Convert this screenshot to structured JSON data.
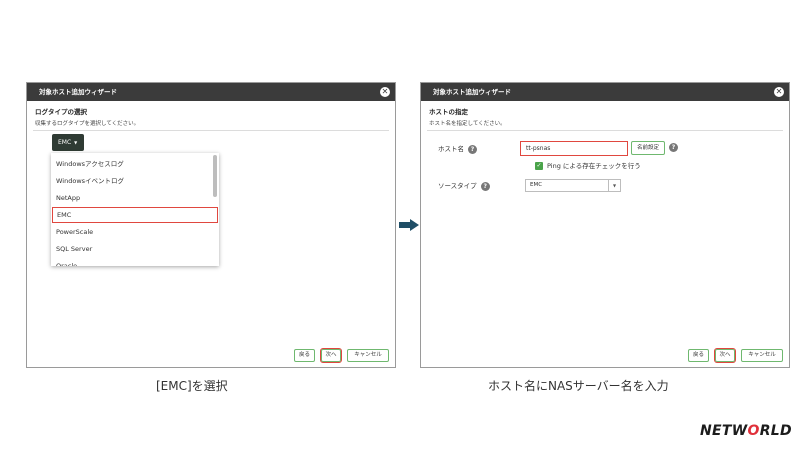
{
  "left_wizard": {
    "title": "対象ホスト追加ウィザード",
    "section_title": "ログタイプの選択",
    "section_desc": "収集するログタイプを選択してください。",
    "selected_label": "EMC",
    "dropdown_items": [
      "Windowsアクセスログ",
      "Windowsイベントログ",
      "NetApp",
      "EMC",
      "PowerScale",
      "SQL Server",
      "Oracle"
    ],
    "selected_index": 3,
    "buttons": {
      "back": "戻る",
      "next": "次へ",
      "cancel": "キャンセル"
    }
  },
  "right_wizard": {
    "title": "対象ホスト追加ウィザード",
    "section_title": "ホストの指定",
    "section_desc": "ホスト名を指定してください。",
    "host_label": "ホスト名",
    "host_value": "tt-psnas",
    "name_button": "名前設定",
    "ping_check": "Ping による存在チェックを行う",
    "ping_checked": true,
    "source_type_label": "ソースタイプ",
    "source_type_value": "EMC",
    "buttons": {
      "back": "戻る",
      "next": "次へ",
      "cancel": "キャンセル"
    }
  },
  "captions": {
    "left": "[EMC]を選択",
    "right": "ホスト名にNASサーバー名を入力"
  },
  "logo": {
    "part1": "NETW",
    "part2": "O",
    "part3": "RLD"
  },
  "colors": {
    "highlight": "#e0473f",
    "titlebar": "#3b3b3b",
    "button_border": "#6fb86f",
    "arrow": "#1f4e66",
    "checkbox": "#4aa34a"
  }
}
